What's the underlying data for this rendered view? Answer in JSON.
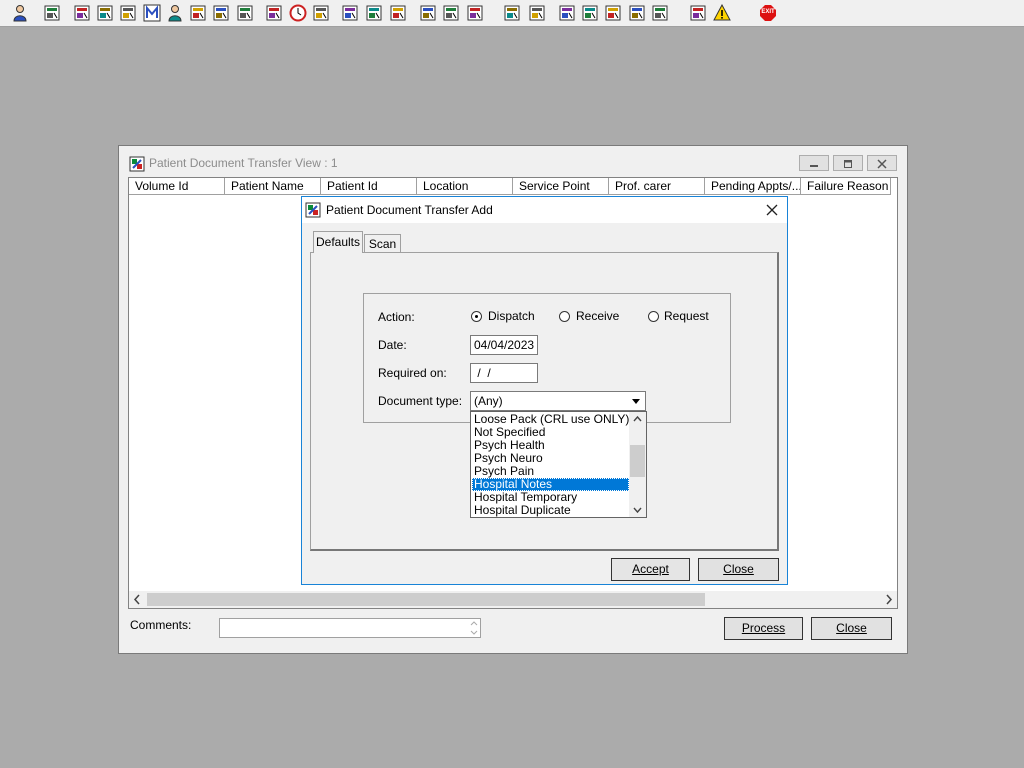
{
  "toolbar": {
    "icons": [
      "person-icon",
      "printer-icon",
      "books-icon",
      "edit-red-icon",
      "grid-icon",
      "letter-m-icon",
      "doctor-icon",
      "notepad-icon",
      "hand-pointer-icon",
      "hand-flag-icon",
      "envelope-icon",
      "clock-icon",
      "monitor-icon",
      "chart-icon",
      "form-icon",
      "gauge-icon",
      "notes-icon",
      "bed-icon",
      "ambulance-icon",
      "document-icon",
      "bar-chart-icon",
      "globe-icon",
      "check-list-icon",
      "check-list-2-icon",
      "green-check-icon",
      "green-arrow-icon",
      "transfer-icon",
      "warning-icon",
      "exit-icon"
    ],
    "exit_label": "EXIT"
  },
  "main_window": {
    "title": "Patient Document Transfer View : 1",
    "columns": [
      "Volume Id",
      "Patient Name",
      "Patient Id",
      "Location",
      "Service Point",
      "Prof. carer",
      "Pending Appts/...",
      "Failure Reason"
    ],
    "comments_label": "Comments:",
    "comments_value": "",
    "process_button": "Process",
    "close_button": "Close"
  },
  "dialog": {
    "title": "Patient Document Transfer Add",
    "tabs": [
      "Defaults",
      "Scan"
    ],
    "action_label": "Action:",
    "action_options": [
      "Dispatch",
      "Receive",
      "Request"
    ],
    "selected_action": "Dispatch",
    "date_label": "Date:",
    "date_value": "04/04/2023",
    "required_label": "Required on:",
    "required_value": " /  /",
    "doctype_label": "Document type:",
    "doctype_value": "(Any)",
    "doctype_options": [
      "Loose Pack (CRL use ONLY)",
      "Not Specified",
      "Psych Health",
      "Psych Neuro",
      "Psych Pain",
      "Hospital Notes",
      "Hospital Temporary",
      "Hospital Duplicate"
    ],
    "doctype_highlighted": "Hospital Notes",
    "accept_button": "Accept",
    "close_button": "Close"
  },
  "colors": {
    "selection": "#0078d7",
    "desktop": "#ababab"
  }
}
